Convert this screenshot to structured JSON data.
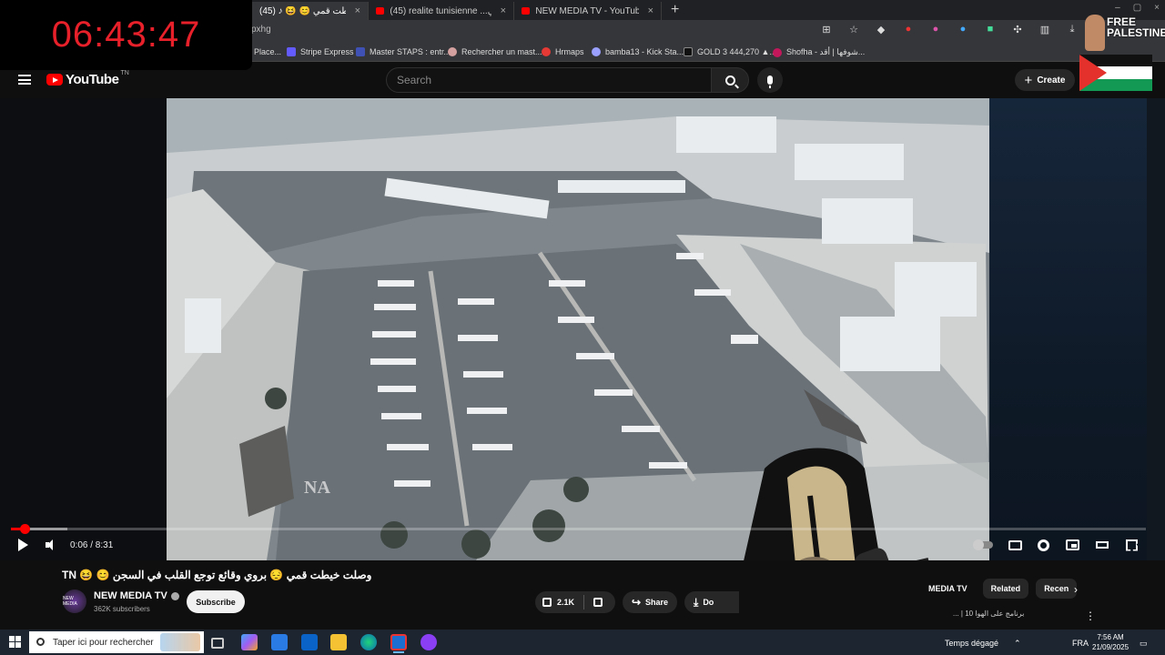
{
  "browser": {
    "tabs": [
      {
        "label": "(45) ♪ 😆 😊 وصلت خيطت قمي"
      },
      {
        "label": "(45) realite tunisienne ...ي التونسي"
      },
      {
        "label": "NEW MEDIA TV - YouTube"
      }
    ],
    "url_fragment": "pxhg",
    "bookmarks": [
      {
        "label": "Place...",
        "color": "#4a90d9"
      },
      {
        "label": "Stripe Express",
        "color": "#635bff"
      },
      {
        "label": "Master STAPS : entr...",
        "color": "#3f51b5"
      },
      {
        "label": "Rechercher un mast...",
        "color": "#d4a0a0"
      },
      {
        "label": "Hrmaps",
        "color": "#e53935"
      },
      {
        "label": "bamba13 - Kick Sta...",
        "color": "#9aa0ff"
      },
      {
        "label": "GOLD 3 444,270 ▲...",
        "color": "#222222"
      },
      {
        "label": "Shofha - شوفها | أقد...",
        "color": "#c2185b"
      }
    ]
  },
  "overlay": {
    "clock": "06:43:47",
    "badge_line1": "FREE",
    "badge_line2": "PALESTINE"
  },
  "youtube": {
    "logo": "YouTube",
    "region": "TN",
    "search_placeholder": "Search",
    "create_label": "Create"
  },
  "player": {
    "time": "0:06 / 8:31",
    "progress_fraction": 0.012,
    "buffered_fraction": 0.05
  },
  "video": {
    "title": "TN 😆 😊 وصلت خيطت قمي 😔 بروي وقائع توجع القلب في السجن",
    "channel": "NEW MEDIA TV",
    "channel_avatar_text": "NEW MEDIA",
    "subscribers": "362K subscribers",
    "subscribe_label": "Subscribe",
    "likes": "2.1K",
    "share_label": "Share",
    "download_label": "Do",
    "watermark": "NA"
  },
  "side": {
    "chips": [
      "MEDIA TV",
      "Related",
      "Recen"
    ],
    "snippet": "برنامج على الهوا 10 | ..."
  },
  "taskbar": {
    "search_placeholder": "Taper ici pour rechercher",
    "weather": "Temps dégagé",
    "lang": "FRA",
    "time": "7:56 AM",
    "date": "21/09/2025"
  }
}
